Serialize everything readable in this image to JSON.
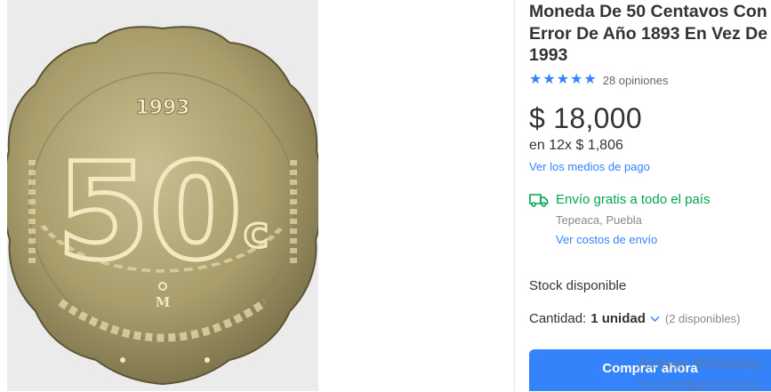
{
  "product": {
    "title": "Moneda De 50 Centavos Con Error De Año 1893 En Vez De 1993",
    "rating_count": "28 opiniones",
    "stars": 5,
    "price": "$ 18,000",
    "installments": "en 12x $ 1,806",
    "payment_link": "Ver los medios de pago",
    "shipping": "Envío gratis a todo el país",
    "location": "Tepeaca, Puebla",
    "shipping_cost_link": "Ver costos de envío",
    "stock": "Stock disponible",
    "quantity_label": "Cantidad:",
    "quantity_value": "1 unidad",
    "quantity_available": "(2 disponibles)",
    "buy_button": "Comprar ahora"
  },
  "coin": {
    "year": "1993",
    "value": "50",
    "currency_sign": "c",
    "mint_mark": "M"
  },
  "watermark": {
    "line1": "Activar Windows",
    "line2": "Ve a Configuración para"
  },
  "colors": {
    "accent": "#3483fa",
    "shipping_green": "#00a650",
    "coin_base": "#a39a6a"
  }
}
